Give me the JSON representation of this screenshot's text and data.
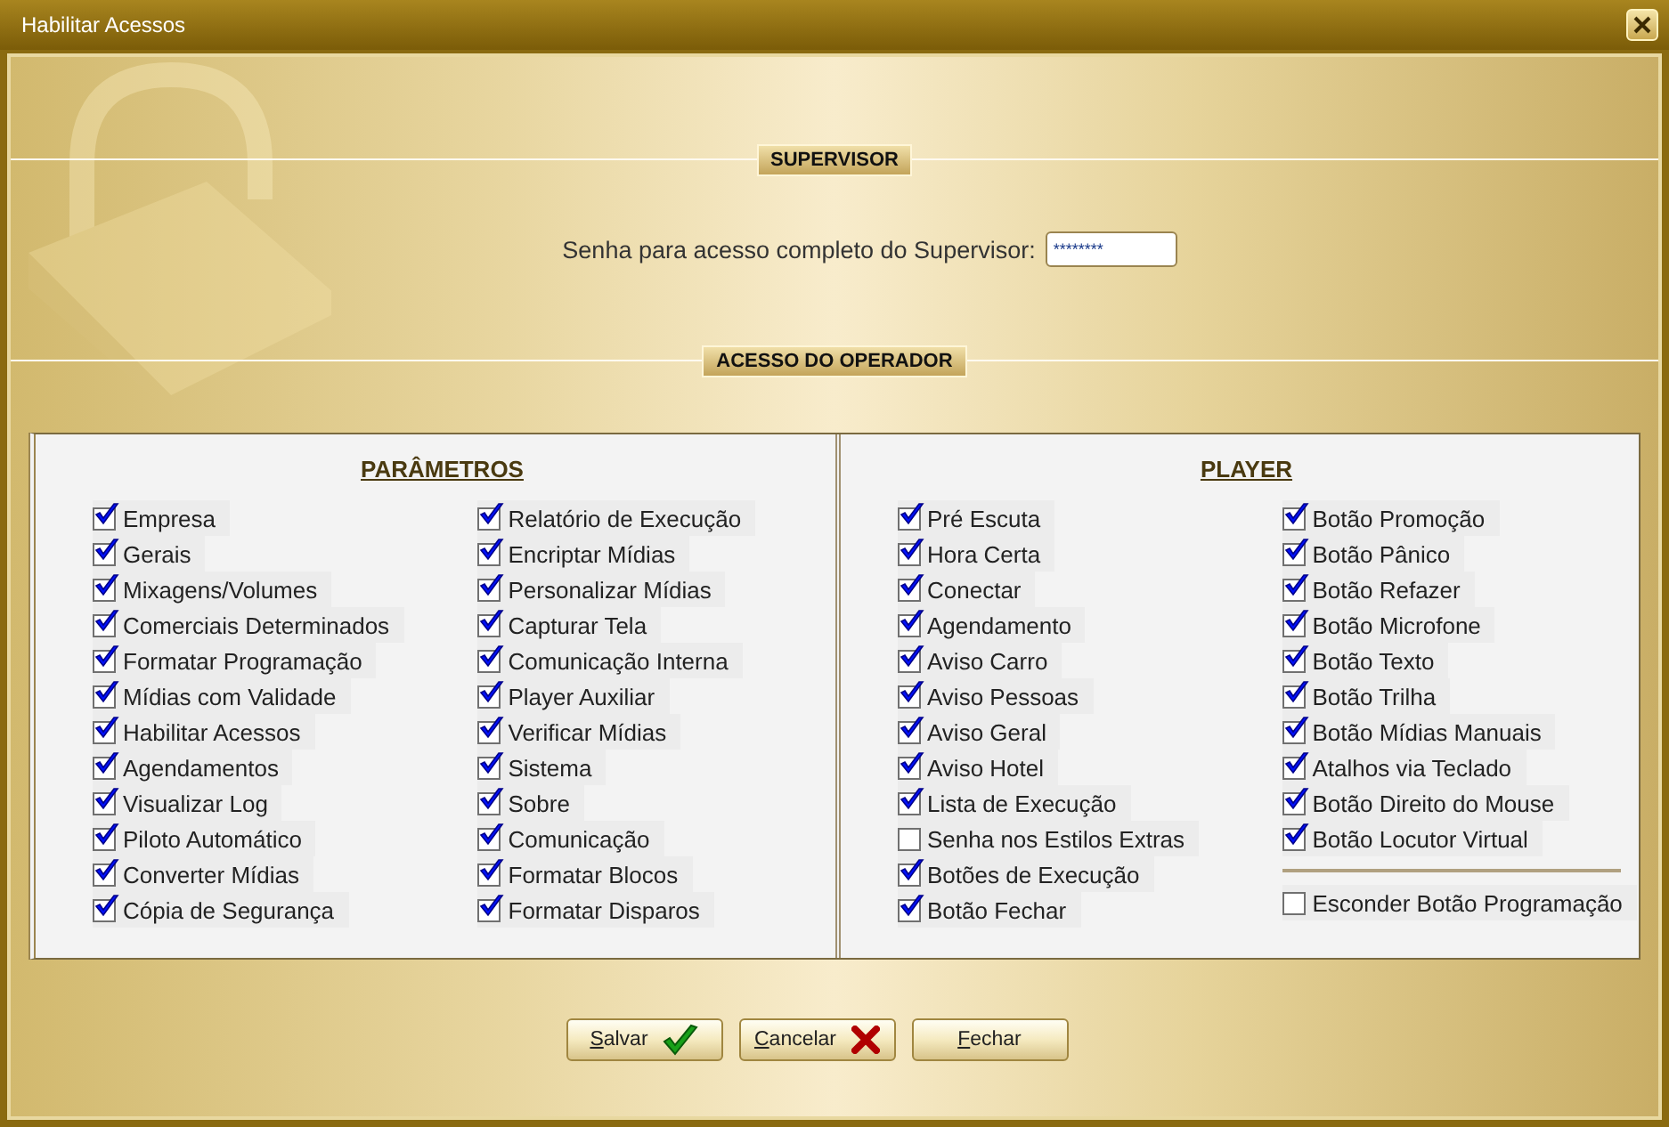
{
  "window": {
    "title": "Habilitar Acessos"
  },
  "supervisor": {
    "heading": "SUPERVISOR",
    "password_label": "Senha para acesso completo do Supervisor:",
    "password_value": "********"
  },
  "operator": {
    "heading": "ACESSO DO OPERADOR",
    "panels": [
      {
        "title": "PARÂMETROS",
        "columns": [
          [
            {
              "kind": "checkbox",
              "label": "Empresa",
              "checked": true
            },
            {
              "kind": "checkbox",
              "label": "Gerais",
              "checked": true
            },
            {
              "kind": "checkbox",
              "label": "Mixagens/Volumes",
              "checked": true
            },
            {
              "kind": "checkbox",
              "label": "Comerciais Determinados",
              "checked": true
            },
            {
              "kind": "checkbox",
              "label": "Formatar Programação",
              "checked": true
            },
            {
              "kind": "checkbox",
              "label": "Mídias com Validade",
              "checked": true
            },
            {
              "kind": "checkbox",
              "label": "Habilitar Acessos",
              "checked": true
            },
            {
              "kind": "checkbox",
              "label": "Agendamentos",
              "checked": true
            },
            {
              "kind": "checkbox",
              "label": "Visualizar Log",
              "checked": true
            },
            {
              "kind": "checkbox",
              "label": "Piloto Automático",
              "checked": true
            },
            {
              "kind": "checkbox",
              "label": "Converter Mídias",
              "checked": true
            },
            {
              "kind": "checkbox",
              "label": "Cópia de Segurança",
              "checked": true
            }
          ],
          [
            {
              "kind": "checkbox",
              "label": "Relatório de Execução",
              "checked": true
            },
            {
              "kind": "checkbox",
              "label": "Encriptar Mídias",
              "checked": true
            },
            {
              "kind": "checkbox",
              "label": "Personalizar Mídias",
              "checked": true
            },
            {
              "kind": "checkbox",
              "label": "Capturar Tela",
              "checked": true
            },
            {
              "kind": "checkbox",
              "label": "Comunicação Interna",
              "checked": true
            },
            {
              "kind": "checkbox",
              "label": "Player Auxiliar",
              "checked": true
            },
            {
              "kind": "checkbox",
              "label": "Verificar Mídias",
              "checked": true
            },
            {
              "kind": "checkbox",
              "label": "Sistema",
              "checked": true
            },
            {
              "kind": "checkbox",
              "label": "Sobre",
              "checked": true
            },
            {
              "kind": "checkbox",
              "label": "Comunicação",
              "checked": true
            },
            {
              "kind": "checkbox",
              "label": "Formatar Blocos",
              "checked": true
            },
            {
              "kind": "checkbox",
              "label": "Formatar Disparos",
              "checked": true
            }
          ]
        ]
      },
      {
        "title": "PLAYER",
        "columns": [
          [
            {
              "kind": "checkbox",
              "label": "Pré Escuta",
              "checked": true
            },
            {
              "kind": "checkbox",
              "label": "Hora Certa",
              "checked": true
            },
            {
              "kind": "checkbox",
              "label": "Conectar",
              "checked": true
            },
            {
              "kind": "checkbox",
              "label": "Agendamento",
              "checked": true
            },
            {
              "kind": "checkbox",
              "label": "Aviso Carro",
              "checked": true
            },
            {
              "kind": "checkbox",
              "label": "Aviso Pessoas",
              "checked": true
            },
            {
              "kind": "checkbox",
              "label": "Aviso Geral",
              "checked": true
            },
            {
              "kind": "checkbox",
              "label": "Aviso Hotel",
              "checked": true
            },
            {
              "kind": "checkbox",
              "label": "Lista de Execução",
              "checked": true
            },
            {
              "kind": "checkbox",
              "label": "Senha nos Estilos Extras",
              "checked": false
            },
            {
              "kind": "checkbox",
              "label": "Botões de Execução",
              "checked": true
            },
            {
              "kind": "checkbox",
              "label": "Botão Fechar",
              "checked": true
            }
          ],
          [
            {
              "kind": "checkbox",
              "label": "Botão Promoção",
              "checked": true
            },
            {
              "kind": "checkbox",
              "label": "Botão Pânico",
              "checked": true
            },
            {
              "kind": "checkbox",
              "label": "Botão Refazer",
              "checked": true
            },
            {
              "kind": "checkbox",
              "label": "Botão Microfone",
              "checked": true
            },
            {
              "kind": "checkbox",
              "label": "Botão Texto",
              "checked": true
            },
            {
              "kind": "checkbox",
              "label": "Botão Trilha",
              "checked": true
            },
            {
              "kind": "checkbox",
              "label": "Botão Mídias Manuais",
              "checked": true
            },
            {
              "kind": "checkbox",
              "label": "Atalhos via Teclado",
              "checked": true
            },
            {
              "kind": "checkbox",
              "label": "Botão Direito do Mouse",
              "checked": true
            },
            {
              "kind": "checkbox",
              "label": "Botão Locutor Virtual",
              "checked": true
            },
            {
              "kind": "separator"
            },
            {
              "kind": "checkbox",
              "label": "Esconder Botão Programação",
              "checked": false
            }
          ]
        ]
      }
    ]
  },
  "buttons": [
    {
      "label": "Salvar",
      "kind": "save"
    },
    {
      "label": "Cancelar",
      "kind": "cancel"
    },
    {
      "label": "Fechar",
      "kind": "close"
    }
  ]
}
